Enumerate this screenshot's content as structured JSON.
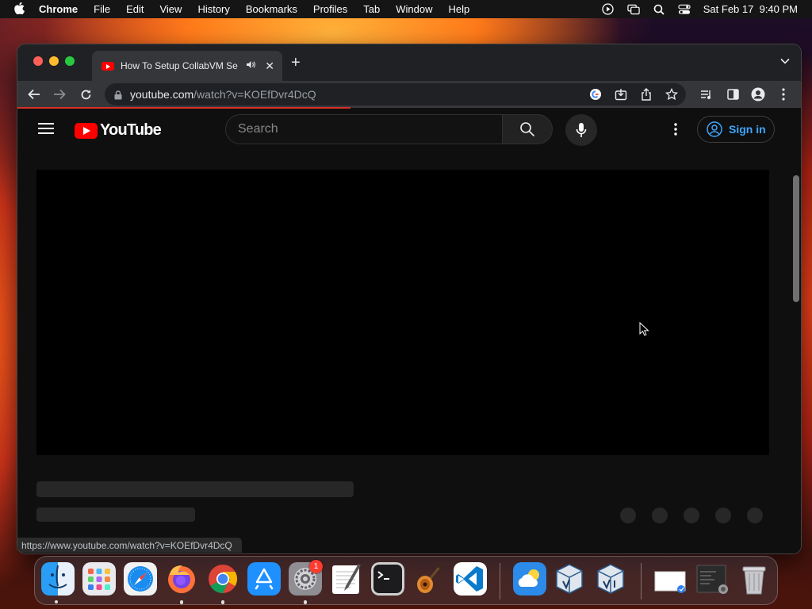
{
  "menubar": {
    "app_name": "Chrome",
    "items": [
      "File",
      "Edit",
      "View",
      "History",
      "Bookmarks",
      "Profiles",
      "Tab",
      "Window",
      "Help"
    ],
    "datetime": "Sat Feb 17  9:40 PM"
  },
  "browser": {
    "tab_title": "How To Setup CollabVM Se",
    "url_host": "youtube.com",
    "url_path": "/watch?v=KOEfDvr4DcQ",
    "status_url": "https://www.youtube.com/watch?v=KOEfDvr4DcQ"
  },
  "youtube": {
    "logo_text": "YouTube",
    "search_placeholder": "Search",
    "signin_label": "Sign in"
  },
  "dock": {
    "apps": [
      "Finder",
      "Launchpad",
      "Safari",
      "Firefox",
      "Chrome",
      "App Store",
      "System Settings",
      "TextEdit",
      "Terminal",
      "GarageBand",
      "Visual Studio Code",
      "Weather",
      "VirtualBox",
      "VirtualBox VM",
      "Preview",
      "Screenshot",
      "Trash"
    ],
    "settings_badge": "1"
  },
  "colors": {
    "youtube_red": "#ff0000",
    "link_blue": "#3ea6ff",
    "chrome_dark": "#35363a"
  }
}
